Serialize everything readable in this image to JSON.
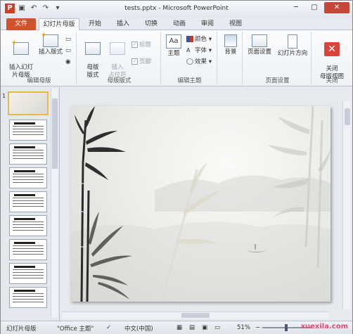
{
  "window": {
    "title": "tests.pptx - Microsoft PowerPoint"
  },
  "quick_access": [
    "save-icon",
    "undo-icon",
    "redo-icon",
    "customize-icon"
  ],
  "tabs": [
    {
      "label": "文件",
      "kind": "file"
    },
    {
      "label": "幻灯片母版",
      "active": true
    },
    {
      "label": "开始"
    },
    {
      "label": "插入"
    },
    {
      "label": "切换"
    },
    {
      "label": "动画"
    },
    {
      "label": "审阅"
    },
    {
      "label": "视图"
    }
  ],
  "ribbon": {
    "edit_master": {
      "label": "编辑母版",
      "insert_master": "插入幻灯\n片母版",
      "insert_layout": "插入版式"
    },
    "master_layout": {
      "label": "母版版式",
      "master_layout_btn": "母版\n版式",
      "insert_placeholder": "插入\n占位符",
      "title_check": "标题",
      "footer_check": "页脚"
    },
    "edit_theme": {
      "label": "编辑主题",
      "themes": "主题",
      "colors": "颜色",
      "fonts": "字体",
      "effects": "效果"
    },
    "background": {
      "label": "背景"
    },
    "page_setup": {
      "label": "页面设置",
      "page_setup_btn": "页面设置",
      "orientation": "幻灯片方向"
    },
    "close": {
      "label": "关闭",
      "close_btn": "关闭\n母版视图"
    }
  },
  "thumbnails": {
    "first_number": "1",
    "count": 10
  },
  "status": {
    "view": "幻灯片母版",
    "theme": "\"Office 主题\"",
    "language": "中文(中国)",
    "zoom": "51%",
    "watermark": "xuexila.com"
  },
  "colors": {
    "file_tab": "#d3522e",
    "close": "#d9453a",
    "accent": "#e8b84a"
  }
}
